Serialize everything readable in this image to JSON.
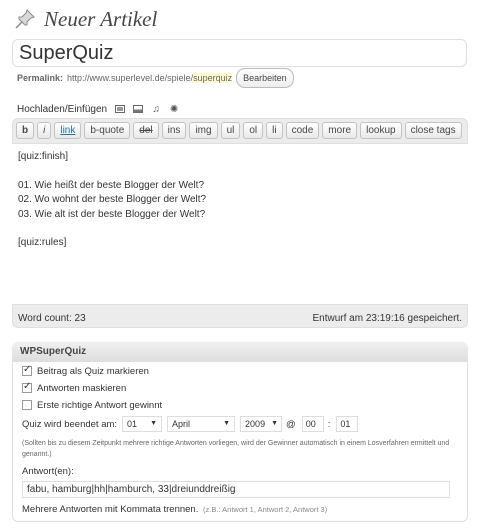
{
  "header": {
    "title": "Neuer Artikel"
  },
  "post": {
    "title": "SuperQuiz",
    "permalink_label": "Permalink:",
    "permalink_base": "http://www.superlevel.de/spiele/",
    "permalink_slug": "superquiz",
    "edit_button": "Bearbeiten"
  },
  "media": {
    "label": "Hochladen/Einfügen",
    "icons": [
      "image-icon",
      "video-icon",
      "audio-icon",
      "media-icon"
    ]
  },
  "quicktags": [
    "b",
    "i",
    "link",
    "b-quote",
    "del",
    "ins",
    "img",
    "ul",
    "ol",
    "li",
    "code",
    "more",
    "lookup",
    "close tags"
  ],
  "editor": {
    "lines": [
      "[quiz:finish]",
      "",
      "01. Wie heißt der beste Blogger der Welt?",
      "02. Wo wohnt der beste Blogger der Welt?",
      "03. Wie alt ist der beste Blogger der Welt?",
      "",
      "[quiz:rules]"
    ],
    "word_count": "Word count: 23",
    "draft_status": "Entwurf am 23:19:16 gespeichert."
  },
  "quiz_panel": {
    "title": "WPSuperQuiz",
    "checkboxes": [
      {
        "label": "Beitrag als Quiz markieren",
        "checked": true
      },
      {
        "label": "Antworten maskieren",
        "checked": true
      },
      {
        "label": "Erste richtige Antwort gewinnt",
        "checked": false
      }
    ],
    "end_label": "Quiz wird beendet am:",
    "day": "01",
    "month": "April",
    "year": "2009",
    "at": "@",
    "hour": "00",
    "colon": ":",
    "minute": "01",
    "hint": "(Sollten bis zu diesem Zeitpunkt mehrere richtige Antworten vorliegen, wird der Gewinner automatisch in einem Losverfahren ermittelt und genannt.)",
    "answers_label": "Antwort(en):",
    "answers_value": "fabu, hamburg|hh|hamburch, 33|dreiunddreißig",
    "answers_note": "Mehrere Antworten mit Kommata trennen.",
    "answers_example": "(z.B.: Antwort 1, Antwort 2, Antwort 3)"
  }
}
